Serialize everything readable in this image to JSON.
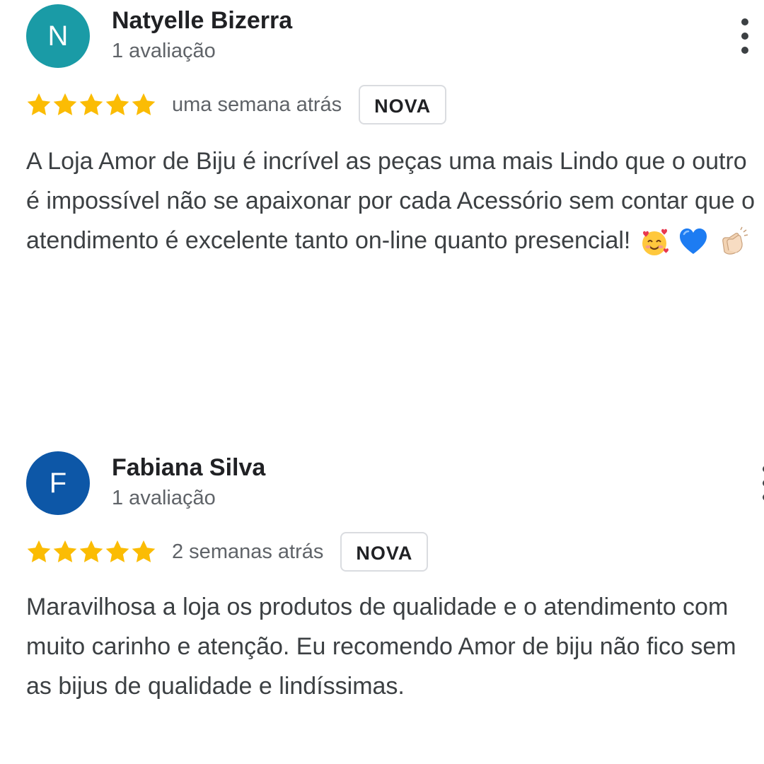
{
  "colors": {
    "star": "#fbbc04",
    "avatar_1": "#1a9ba6",
    "avatar_2": "#0d57a7",
    "muted_text": "#5f6368",
    "body_text": "#3c4043"
  },
  "reviews": [
    {
      "avatar_letter": "N",
      "name": "Natyelle Bizerra",
      "review_count": "1 avaliação",
      "rating": 5,
      "when": "uma semana atrás",
      "badge": "NOVA",
      "text": "A Loja Amor de Biju é incrível as peças uma mais Lindo que o outro é impossível não se apaixonar por cada Acessório sem contar que o atendimento é excelente tanto on-line quanto presencial!",
      "emojis": [
        "smiling-face-with-hearts-icon",
        "blue-heart-icon",
        "clapping-hands-icon"
      ]
    },
    {
      "avatar_letter": "F",
      "name": "Fabiana Silva",
      "review_count": "1 avaliação",
      "rating": 5,
      "when": "2 semanas atrás",
      "badge": "NOVA",
      "text": "Maravilhosa a loja os produtos de qualidade e o atendimento com muito carinho e atenção. Eu recomendo Amor de biju não fico sem as bijus de qualidade e lindíssimas."
    }
  ]
}
